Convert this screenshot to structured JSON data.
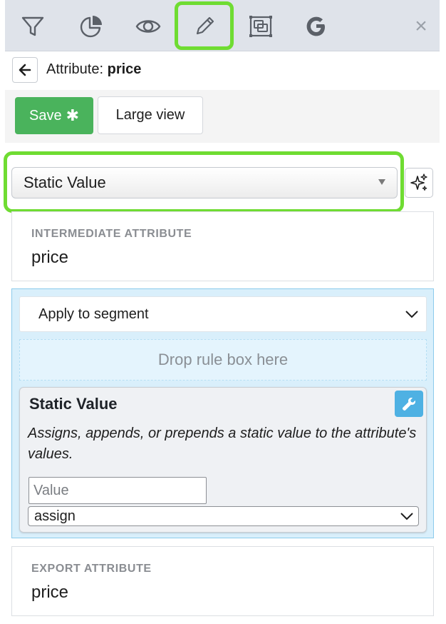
{
  "toolbar": {
    "icons": [
      "filter-icon",
      "pie-chart-icon",
      "eye-icon",
      "pencil-icon",
      "frame-icon",
      "google-icon",
      "close-icon"
    ],
    "close_symbol": "×",
    "highlight_color": "#6fdc32"
  },
  "header": {
    "title_prefix": "Attribute:",
    "title_name": "price"
  },
  "actions": {
    "save_label": "Save",
    "save_marker": "✱",
    "large_view_label": "Large view",
    "save_color": "#4ab35c"
  },
  "type_select": {
    "value": "Static Value"
  },
  "intermediate": {
    "caption": "INTERMEDIATE ATTRIBUTE",
    "value": "price"
  },
  "rules": {
    "segment_label": "Apply to segment",
    "drop_label": "Drop rule box here",
    "card": {
      "title": "Static Value",
      "description": "Assigns, appends, or prepends a static value to the attribute's values.",
      "value_placeholder": "Value",
      "mode_value": "assign"
    }
  },
  "export": {
    "caption": "EXPORT ATTRIBUTE",
    "value": "price"
  }
}
